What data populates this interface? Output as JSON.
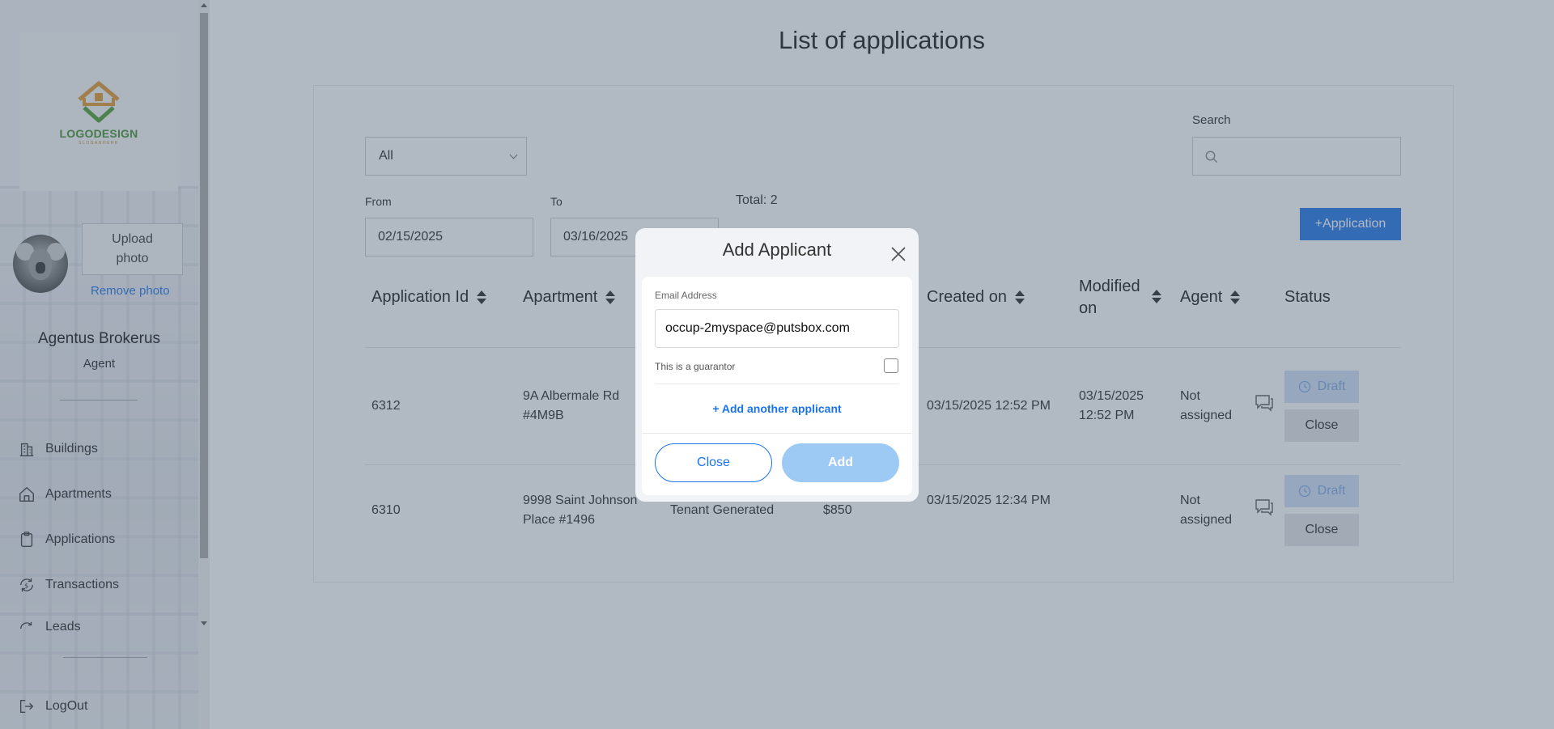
{
  "sidebar": {
    "logo": {
      "text": "LOGODESIGN",
      "sub": "SLOGANHERE"
    },
    "upload_photo": "Upload photo",
    "remove_photo": "Remove photo",
    "user_name": "Agentus Brokerus",
    "user_role": "Agent",
    "nav": [
      {
        "label": "Buildings",
        "icon": "building-icon"
      },
      {
        "label": "Apartments",
        "icon": "home-icon"
      },
      {
        "label": "Applications",
        "icon": "clipboard-icon"
      },
      {
        "label": "Transactions",
        "icon": "transactions-icon"
      },
      {
        "label": "Leads",
        "icon": "leads-icon"
      }
    ],
    "logout": "LogOut"
  },
  "main": {
    "title": "List of applications",
    "filter_select": "All",
    "search_label": "Search",
    "search_placeholder": "",
    "from_label": "From",
    "to_label": "To",
    "from_value": "02/15/2025",
    "to_value": "03/16/2025",
    "total": "Total: 2",
    "add_application": "+Application",
    "table": {
      "headers": {
        "application_id": "Application Id",
        "apartment": "Apartment",
        "created_on": "Created on",
        "modified_on": "Modified on",
        "agent": "Agent",
        "status": "Status"
      },
      "rows": [
        {
          "id": "6312",
          "apartment": "9A Albermale Rd #4M9B",
          "created": "03/15/2025 12:52 PM",
          "modified": "03/15/2025 12:52 PM",
          "agent": "Not assigned",
          "status": "Draft",
          "close": "Close"
        },
        {
          "id": "6310",
          "apartment": "9998 Saint Johnson Place #1496",
          "source": "Tenant Generated",
          "price": "$850",
          "created": "03/15/2025 12:34 PM",
          "modified": "",
          "agent": "Not assigned",
          "status": "Draft",
          "close": "Close"
        }
      ]
    }
  },
  "modal": {
    "title": "Add Applicant",
    "email_label": "Email Address",
    "email_value": "occup-2myspace@putsbox.com",
    "guarantor_label": "This is a guarantor",
    "guarantor_checked": false,
    "add_another": "+ Add another applicant",
    "close_button": "Close",
    "add_button": "Add"
  },
  "colors": {
    "accent": "#1a73e8",
    "overlay": "#536378",
    "draft_badge": "#cfe0f7",
    "add_button_disabled": "#9ccaf5"
  }
}
